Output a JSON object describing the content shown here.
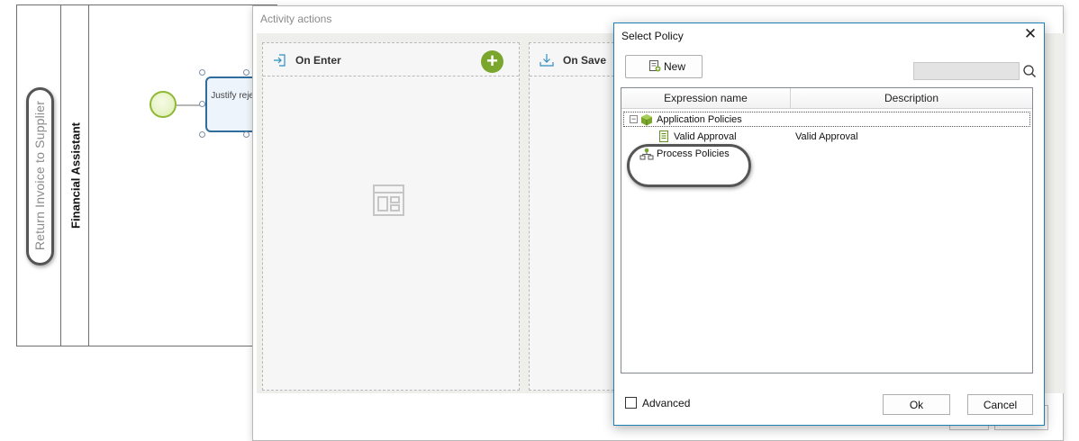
{
  "bpmn": {
    "pool_name": "Return Invoice to Supplier",
    "lane_name": "Financial Assistant",
    "task_text": "Justify reject"
  },
  "activity_actions": {
    "title": "Activity actions",
    "panels": [
      {
        "label": "On Enter"
      },
      {
        "label": "On Save"
      }
    ],
    "add_symbol": "+"
  },
  "select_policy": {
    "title": "Select Policy",
    "close_symbol": "✕",
    "new_button_label": "New",
    "search": {
      "value": "",
      "placeholder": ""
    },
    "columns": [
      "Expression name",
      "Description"
    ],
    "tree": {
      "expander_symbol": "−",
      "items": [
        {
          "name": "Application Policies",
          "description": "",
          "icon": "green-cube-icon"
        },
        {
          "name": "Valid Approval",
          "description": "Valid Approval",
          "icon": "policy-document-icon"
        },
        {
          "name": "Process Policies",
          "description": "",
          "icon": "process-hierarchy-icon"
        }
      ]
    },
    "advanced_label": "Advanced",
    "advanced_checked": false,
    "ok_label": "Ok",
    "cancel_label": "Cancel"
  },
  "colors": {
    "accent_blue": "#1f7fb0",
    "add_green": "#7aa62d",
    "start_event_green": "#8fb834"
  }
}
